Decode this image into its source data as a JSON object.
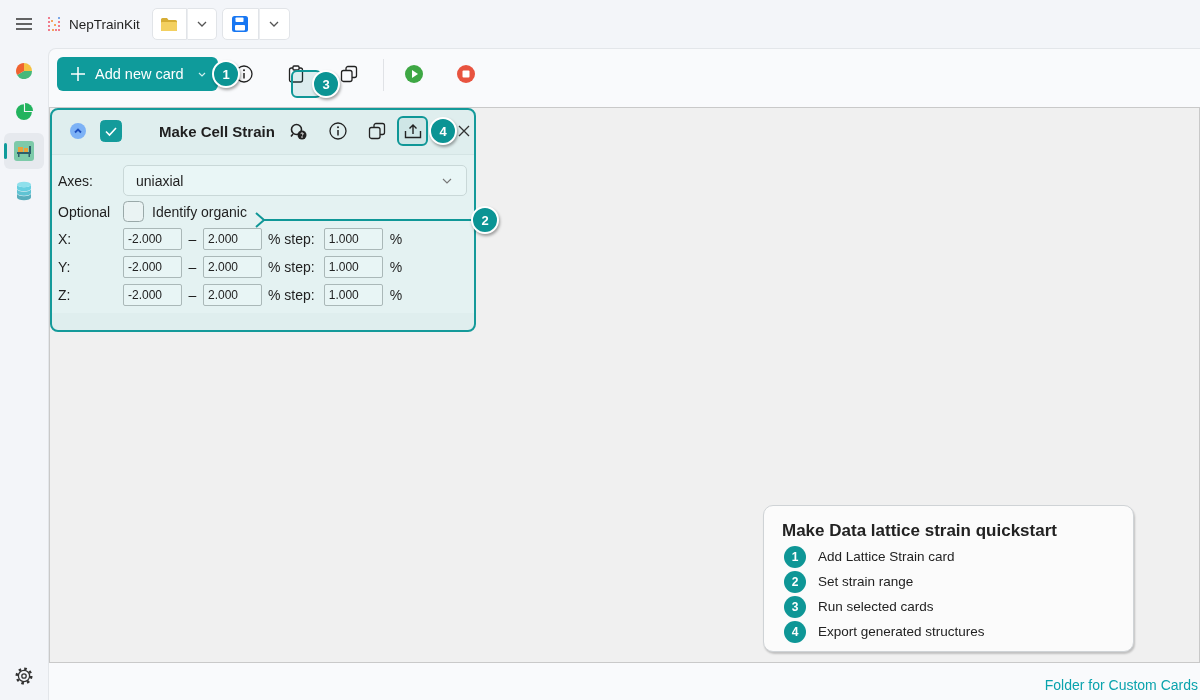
{
  "app": {
    "title": "NepTrainKit"
  },
  "sidebar": {
    "items": [
      {
        "kind": "chart",
        "selected": false
      },
      {
        "kind": "pie",
        "selected": false
      },
      {
        "kind": "bench",
        "selected": true
      },
      {
        "kind": "database",
        "selected": false
      }
    ]
  },
  "toolbar": {
    "add_button": "Add new card"
  },
  "card": {
    "title": "Make Cell Strain",
    "expanded": true,
    "checked": true,
    "axes": {
      "label": "Axes:",
      "value": "uniaxial"
    },
    "optional": {
      "label": "Optional",
      "option": "Identify organic",
      "checked": false
    },
    "ranges": [
      {
        "axis": "X:",
        "min": "-2.000",
        "separator": "–",
        "max": "2.000",
        "step_label": "% step:",
        "step": "1.000",
        "unit": "%"
      },
      {
        "axis": "Y:",
        "min": "-2.000",
        "separator": "–",
        "max": "2.000",
        "step_label": "% step:",
        "step": "1.000",
        "unit": "%"
      },
      {
        "axis": "Z:",
        "min": "-2.000",
        "separator": "–",
        "max": "2.000",
        "step_label": "% step:",
        "step": "1.000",
        "unit": "%"
      }
    ]
  },
  "guide_markers": [
    {
      "number": "1",
      "kind": "plain"
    },
    {
      "number": "2",
      "kind": "pointer"
    },
    {
      "number": "3",
      "kind": "highlight"
    },
    {
      "number": "4",
      "kind": "highlight"
    }
  ],
  "quickstart": {
    "title": "Make Data lattice strain quickstart",
    "steps": [
      {
        "number": "1",
        "text": "Add Lattice Strain card"
      },
      {
        "number": "2",
        "text": "Set strain range"
      },
      {
        "number": "3",
        "text": "Run selected cards"
      },
      {
        "number": "4",
        "text": "Export generated structures"
      }
    ]
  },
  "footer": {
    "link": "Folder for Custom Cards"
  }
}
